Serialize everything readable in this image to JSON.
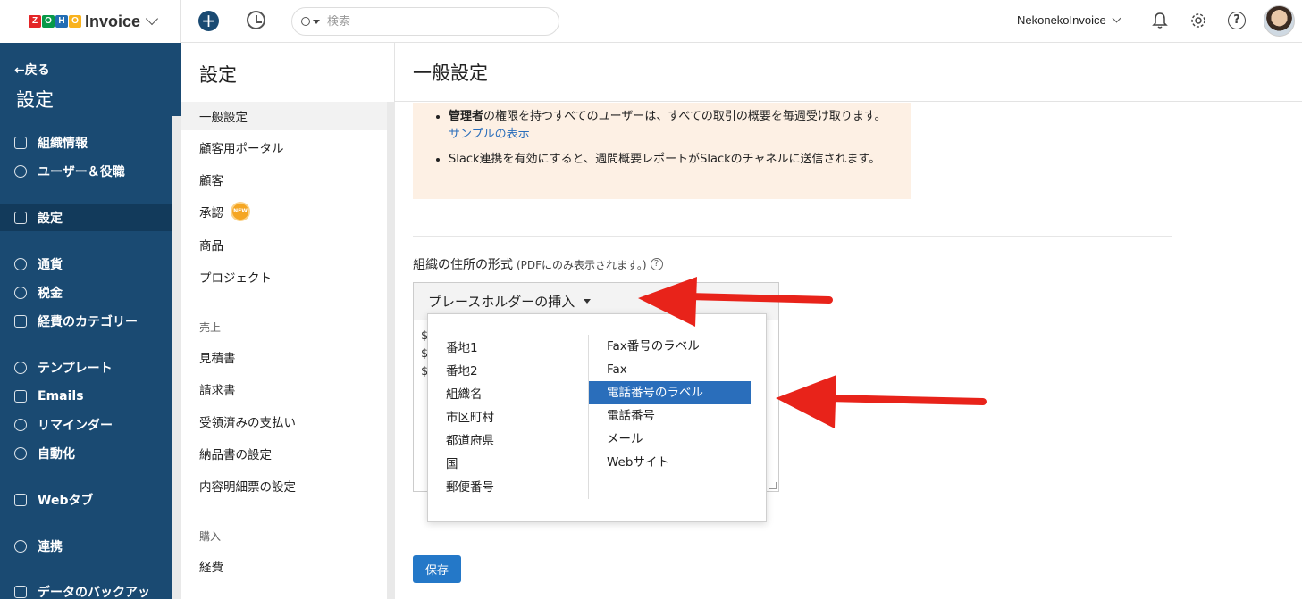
{
  "topbar": {
    "brand_letters": [
      "Z",
      "O",
      "H",
      "O"
    ],
    "brand_letter_colors": [
      "#e42527",
      "#089949",
      "#226db4",
      "#f9b21d"
    ],
    "brand_name": "Invoice",
    "plus_label": "+",
    "search_placeholder": "検索",
    "org_name": "NekonekoInvoice",
    "help_label": "?"
  },
  "sidebar": {
    "back_label": "←戻る",
    "title": "設定",
    "items": [
      {
        "label": "組織情報",
        "icon": "building-icon"
      },
      {
        "label": "ユーザー＆役職",
        "icon": "users-icon"
      },
      {
        "label": "設定",
        "icon": "sliders-icon",
        "active": true
      },
      {
        "label": "通貨",
        "icon": "currency-icon"
      },
      {
        "label": "税金",
        "icon": "percent-icon"
      },
      {
        "label": "経費のカテゴリー",
        "icon": "category-icon"
      },
      {
        "label": "テンプレート",
        "icon": "palette-icon"
      },
      {
        "label": "Emails",
        "icon": "mail-icon"
      },
      {
        "label": "リマインダー",
        "icon": "bell-icon"
      },
      {
        "label": "自動化",
        "icon": "refresh-icon"
      },
      {
        "label": "Webタブ",
        "icon": "tab-icon"
      },
      {
        "label": "連携",
        "icon": "plug-icon"
      },
      {
        "label": "データのバックアッ",
        "icon": "database-icon"
      }
    ]
  },
  "settings": {
    "title": "設定",
    "items": [
      {
        "label": "一般設定",
        "active": true
      },
      {
        "label": "顧客用ポータル"
      },
      {
        "label": "顧客"
      },
      {
        "label": "承認",
        "badge": "NEW"
      },
      {
        "label": "商品"
      },
      {
        "label": "プロジェクト"
      }
    ],
    "group_sales": "売上",
    "sales_items": [
      "見積書",
      "請求書",
      "受領済みの支払い",
      "納品書の設定",
      "内容明細票の設定"
    ],
    "group_purchase": "購入",
    "purchase_items": [
      "経費"
    ]
  },
  "main": {
    "title": "一般設定",
    "note": {
      "line1_bold": "管理者",
      "line1_rest": "の権限を持つすべてのユーザーは、すべての取引の概要を毎週受け取ります。",
      "line1_link": "サンプルの表示",
      "line2": "Slack連携を有効にすると、週間概要レポートがSlackのチャネルに送信されます。"
    },
    "address": {
      "label": "組織の住所の形式",
      "hint": "(PDFにのみ表示されます。)",
      "help": "?",
      "toolbar_label": "プレースホルダーの挿入",
      "body_lines": [
        "$",
        "$",
        "$"
      ]
    },
    "dropdown": {
      "left": [
        "番地1",
        "番地2",
        "組織名",
        "市区町村",
        "都道府県",
        "国",
        "郵便番号"
      ],
      "right": [
        "Fax番号のラベル",
        "Fax",
        "電話番号のラベル",
        "電話番号",
        "メール",
        "Webサイト"
      ],
      "active_right_index": 2
    },
    "save_label": "保存"
  },
  "colors": {
    "sidebar_bg": "#1a4a72",
    "accent": "#2478c8",
    "note_bg": "#fdf0e4",
    "arrow": "#e8231a"
  }
}
